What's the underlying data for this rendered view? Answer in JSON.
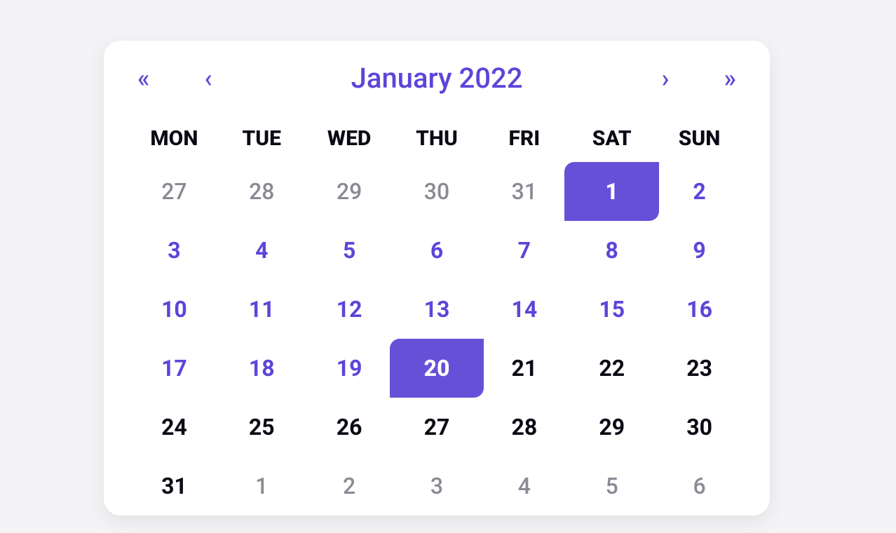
{
  "colors": {
    "accent": "#5b46d9",
    "selected_bg": "#6750d8",
    "text_dark": "#0a0914",
    "text_muted": "#8a8a94",
    "card_bg": "#ffffff",
    "page_bg": "#f4f4f6"
  },
  "header": {
    "month_year": "January 2022",
    "nav": {
      "prev_year": "«",
      "prev_month": "‹",
      "next_month": "›",
      "next_year": "»"
    }
  },
  "weekdays": [
    "MON",
    "TUE",
    "WED",
    "THU",
    "FRI",
    "SAT",
    "SUN"
  ],
  "weeks": [
    [
      {
        "d": "27",
        "state": "other"
      },
      {
        "d": "28",
        "state": "other"
      },
      {
        "d": "29",
        "state": "other"
      },
      {
        "d": "30",
        "state": "other"
      },
      {
        "d": "31",
        "state": "other"
      },
      {
        "d": "1",
        "state": "selected"
      },
      {
        "d": "2",
        "state": "past"
      }
    ],
    [
      {
        "d": "3",
        "state": "past"
      },
      {
        "d": "4",
        "state": "past"
      },
      {
        "d": "5",
        "state": "past"
      },
      {
        "d": "6",
        "state": "past"
      },
      {
        "d": "7",
        "state": "past"
      },
      {
        "d": "8",
        "state": "past"
      },
      {
        "d": "9",
        "state": "past"
      }
    ],
    [
      {
        "d": "10",
        "state": "past"
      },
      {
        "d": "11",
        "state": "past"
      },
      {
        "d": "12",
        "state": "past"
      },
      {
        "d": "13",
        "state": "past"
      },
      {
        "d": "14",
        "state": "past"
      },
      {
        "d": "15",
        "state": "past"
      },
      {
        "d": "16",
        "state": "past"
      }
    ],
    [
      {
        "d": "17",
        "state": "past"
      },
      {
        "d": "18",
        "state": "past"
      },
      {
        "d": "19",
        "state": "past"
      },
      {
        "d": "20",
        "state": "selected"
      },
      {
        "d": "21",
        "state": "current"
      },
      {
        "d": "22",
        "state": "current"
      },
      {
        "d": "23",
        "state": "current"
      }
    ],
    [
      {
        "d": "24",
        "state": "current"
      },
      {
        "d": "25",
        "state": "current"
      },
      {
        "d": "26",
        "state": "current"
      },
      {
        "d": "27",
        "state": "current"
      },
      {
        "d": "28",
        "state": "current"
      },
      {
        "d": "29",
        "state": "current"
      },
      {
        "d": "30",
        "state": "current"
      }
    ],
    [
      {
        "d": "31",
        "state": "current"
      },
      {
        "d": "1",
        "state": "other"
      },
      {
        "d": "2",
        "state": "other"
      },
      {
        "d": "3",
        "state": "other"
      },
      {
        "d": "4",
        "state": "other"
      },
      {
        "d": "5",
        "state": "other"
      },
      {
        "d": "6",
        "state": "other"
      }
    ]
  ]
}
